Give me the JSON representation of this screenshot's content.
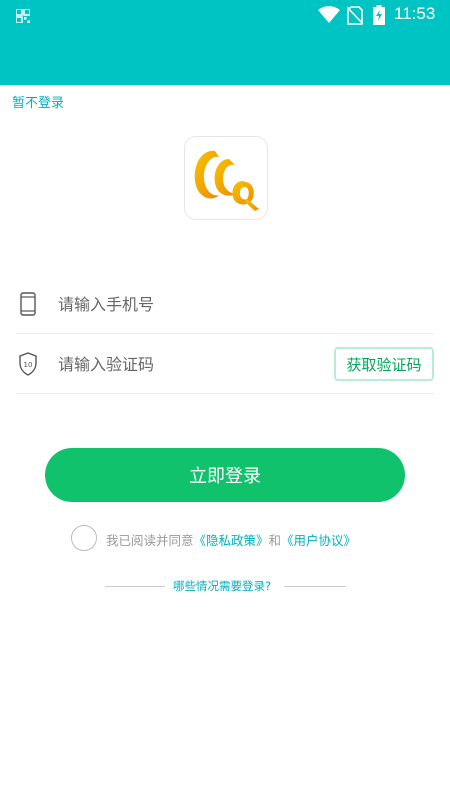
{
  "status_bar": {
    "time": "11:53",
    "icons": [
      "qr-icon",
      "wifi-icon",
      "no-sim-icon",
      "battery-charging-icon"
    ],
    "background_color": "#00c4c4"
  },
  "header": {
    "skip_label": "暂不登录"
  },
  "logo": {
    "icon": "app-logo-icon",
    "colors": [
      "#f5b800",
      "#f08a00"
    ]
  },
  "form": {
    "phone": {
      "placeholder": "请输入手机号",
      "value": "",
      "icon": "phone-icon"
    },
    "code": {
      "placeholder": "请输入验证码",
      "value": "",
      "icon": "shield-icon",
      "get_code_label": "获取验证码"
    }
  },
  "login_button": {
    "label": "立即登录",
    "color": "#11c26d"
  },
  "agreement": {
    "checked": false,
    "prefix": "我已阅读并同意",
    "privacy_link": "《隐私政策》",
    "conjunction": "和",
    "user_agreement_link": "《用户协议》"
  },
  "help": {
    "label": "哪些情况需要登录?"
  },
  "colors": {
    "accent": "#00b0c0",
    "primary": "#11c26d"
  }
}
